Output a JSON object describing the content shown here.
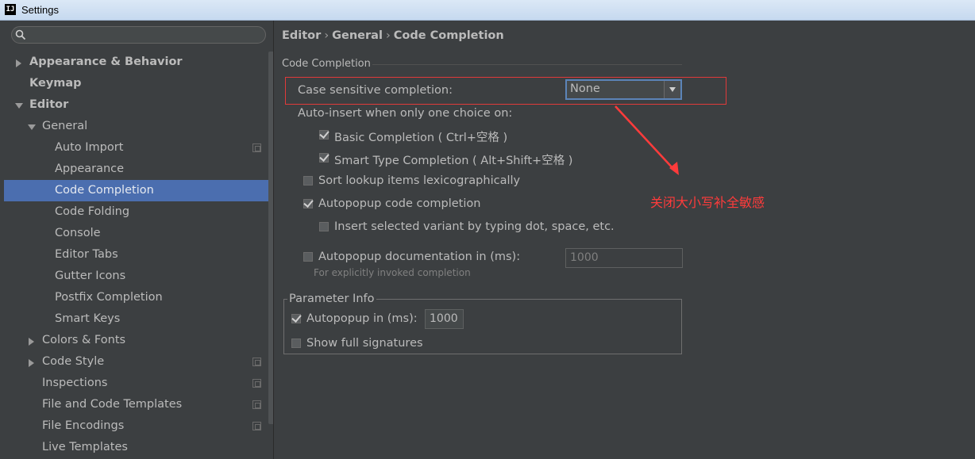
{
  "window": {
    "title": "Settings",
    "app_icon": "IJ"
  },
  "sidebar": {
    "search": {
      "placeholder": "",
      "value": ""
    },
    "items": [
      {
        "label": "Appearance & Behavior",
        "bold": true
      },
      {
        "label": "Keymap",
        "bold": true
      },
      {
        "label": "Editor",
        "bold": true
      },
      {
        "label": "General"
      },
      {
        "label": "Auto Import"
      },
      {
        "label": "Appearance"
      },
      {
        "label": "Code Completion",
        "selected": true
      },
      {
        "label": "Code Folding"
      },
      {
        "label": "Console"
      },
      {
        "label": "Editor Tabs"
      },
      {
        "label": "Gutter Icons"
      },
      {
        "label": "Postfix Completion"
      },
      {
        "label": "Smart Keys"
      },
      {
        "label": "Colors & Fonts"
      },
      {
        "label": "Code Style"
      },
      {
        "label": "Inspections"
      },
      {
        "label": "File and Code Templates"
      },
      {
        "label": "File Encodings"
      },
      {
        "label": "Live Templates"
      }
    ]
  },
  "breadcrumb": {
    "part1": "Editor",
    "part2": "General",
    "part3": "Code Completion",
    "separator": "›"
  },
  "code_completion": {
    "section_title": "Code Completion",
    "case_sensitive_label": "Case sensitive completion:",
    "case_sensitive_value": "None",
    "auto_insert_label": "Auto-insert when only one choice on:",
    "basic_completion": {
      "label": "Basic Completion ( Ctrl+空格 )",
      "checked": true
    },
    "smart_type_completion": {
      "label": "Smart Type Completion ( Alt+Shift+空格 )",
      "checked": true
    },
    "sort_lookup": {
      "label": "Sort lookup items lexicographically",
      "checked": false
    },
    "autopopup_code": {
      "label": "Autopopup code completion",
      "checked": true
    },
    "insert_selected": {
      "label": "Insert selected variant by typing dot, space, etc.",
      "checked": false
    },
    "autopopup_doc": {
      "label": "Autopopup documentation in (ms):",
      "checked": false,
      "value": "1000"
    },
    "autopopup_doc_hint": "For explicitly invoked completion"
  },
  "parameter_info": {
    "title": "Parameter Info",
    "autopopup": {
      "label": "Autopopup in (ms):",
      "checked": true,
      "value": "1000"
    },
    "show_full_signatures": {
      "label": "Show full signatures",
      "checked": false
    }
  },
  "annotation": {
    "text": "关闭大小写补全敏感",
    "color": "#ff3b3b"
  },
  "colors": {
    "background": "#3c3f41",
    "selection": "#4b6eaf",
    "annotation_box": "#e03a3a"
  }
}
